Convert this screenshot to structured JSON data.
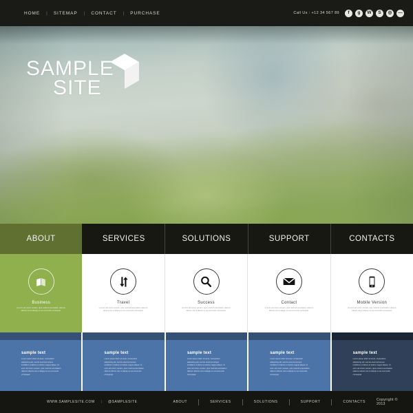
{
  "topbar": {
    "nav": [
      {
        "label": "HOME"
      },
      {
        "label": "SITEMAP"
      },
      {
        "label": "CONTACT"
      },
      {
        "label": "PURCHASE"
      }
    ],
    "separator": "|",
    "call_us": "Call Us : +12 34 567 89",
    "socials": [
      {
        "name": "facebook-icon",
        "glyph": "f"
      },
      {
        "name": "google-plus-icon",
        "glyph": "g"
      },
      {
        "name": "wordpress-icon",
        "glyph": "W"
      },
      {
        "name": "skype-icon",
        "glyph": "S"
      },
      {
        "name": "flickr-icon",
        "glyph": "◎"
      },
      {
        "name": "rss-icon",
        "glyph": "—"
      }
    ]
  },
  "hero": {
    "logo_line1": "SAMPLE",
    "logo_line2": "SITE",
    "logo_icon": "cube-logo-icon"
  },
  "mainnav": {
    "items": [
      {
        "label": "ABOUT",
        "active": true
      },
      {
        "label": "SERVICES",
        "active": false
      },
      {
        "label": "SOLUTIONS",
        "active": false
      },
      {
        "label": "SUPPORT",
        "active": false
      },
      {
        "label": "CONTACTS",
        "active": false
      }
    ]
  },
  "features": [
    {
      "title": "Business",
      "icon": "book-icon",
      "desc": "Ut enim ad minim veniam, quis nostrud exercitation ullamco laboris nisi ut aliquip ex ea commodo consequat."
    },
    {
      "title": "Travel",
      "icon": "transfer-arrows-icon",
      "desc": "Ut enim ad minim veniam, quis nostrud exercitation ullamco laboris nisi ut aliquip ex ea commodo consequat."
    },
    {
      "title": "Success",
      "icon": "magnifier-icon",
      "desc": "Ut enim ad minim veniam, quis nostrud exercitation ullamco laboris nisi ut aliquip ex ea commodo consequat."
    },
    {
      "title": "Contact",
      "icon": "envelope-icon",
      "desc": "Ut enim ad minim veniam, quis nostrud exercitation ullamco laboris nisi ut aliquip ex ea commodo consequat."
    },
    {
      "title": "Mobile Version",
      "icon": "smartphone-icon",
      "desc": "Ut enim ad minim veniam, quis nostrud exercitation ullamco laboris nisi ut aliquip ex ea commodo consequat."
    }
  ],
  "panels": [
    {
      "title": "sample text",
      "desc": "Lorem ipsum dolor sit amet, consectetur adipisicing elit, sed do eiusmod tempor incididunt ut labore et dolore magna aliqua. Ut enim ad minim veniam, quis nostrud exercitation ullamco laboris nisi ut aliquip ex ea commodo consequat."
    },
    {
      "title": "sample text",
      "desc": "Lorem ipsum dolor sit amet, consectetur adipisicing elit, sed do eiusmod tempor incididunt ut labore et dolore magna aliqua. Ut enim ad minim veniam, quis nostrud exercitation ullamco laboris nisi ut aliquip ex ea commodo consequat."
    },
    {
      "title": "sample text",
      "desc": "Lorem ipsum dolor sit amet, consectetur adipisicing elit, sed do eiusmod tempor incididunt ut labore et dolore magna aliqua. Ut enim ad minim veniam, quis nostrud exercitation ullamco laboris nisi ut aliquip ex ea commodo consequat."
    },
    {
      "title": "sample text",
      "desc": "Lorem ipsum dolor sit amet, consectetur adipisicing elit, sed do eiusmod tempor incididunt ut labore et dolore magna aliqua. Ut enim ad minim veniam, quis nostrud exercitation ullamco laboris nisi ut aliquip ex ea commodo consequat."
    },
    {
      "title": "sample text",
      "desc": "Lorem ipsum dolor sit amet, consectetur adipisicing elit, sed do eiusmod tempor incididunt ut labore et dolore magna aliqua. Ut enim ad minim veniam, quis nostrud exercitation ullamco laboris nisi ut aliquip ex ea commodo consequat."
    }
  ],
  "footer": {
    "website": "WWW.SAMPLESITE.COM",
    "separator": "|",
    "handle": "@SAMPLESITE",
    "nav": [
      {
        "label": "ABOUT"
      },
      {
        "label": "SERVICES"
      },
      {
        "label": "SOLUTIONS"
      },
      {
        "label": "SUPPORT"
      },
      {
        "label": "CONTACTS"
      }
    ],
    "copyright": "Copyright © 2013"
  },
  "colors": {
    "dark": "#151611",
    "green_accent": "#8fb04c",
    "nav_active": "#5f7031",
    "panel_blue": "#4c74a8",
    "panel_navy": "#2f4058"
  }
}
